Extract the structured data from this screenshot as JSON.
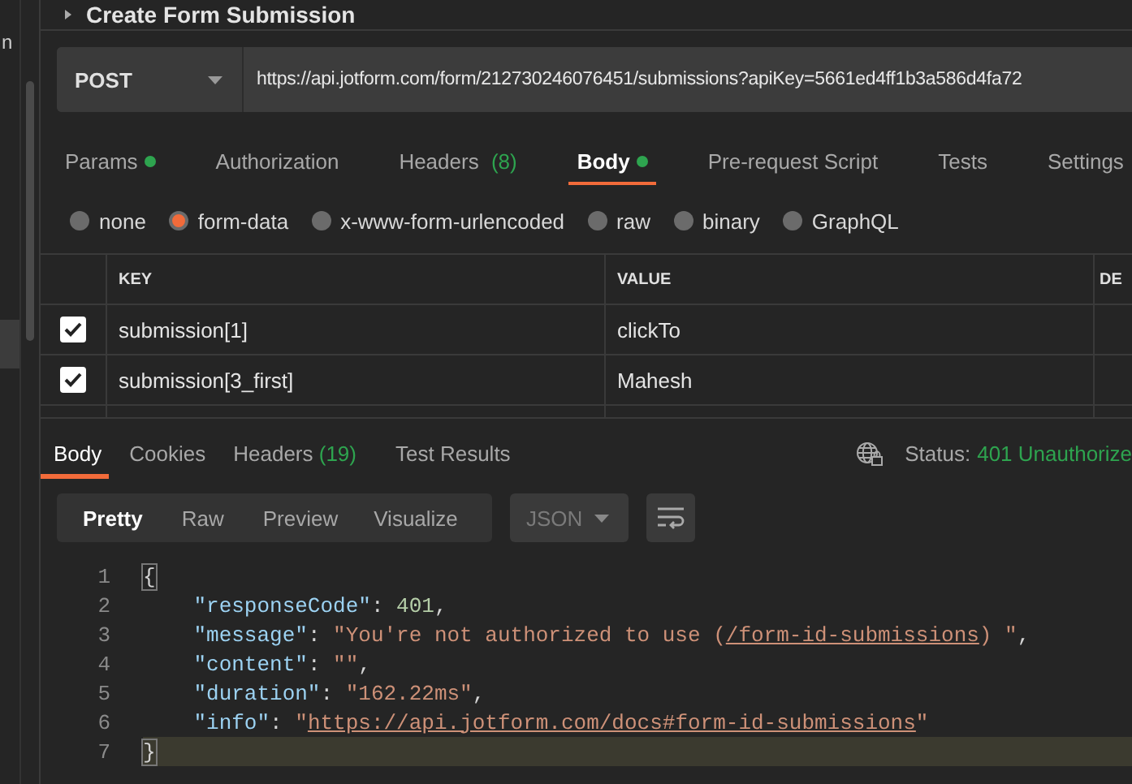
{
  "sidebar": {
    "text": "n"
  },
  "request": {
    "title": "Create Form Submission",
    "method": "POST",
    "url": "https://api.jotform.com/form/212730246076451/submissions?apiKey=5661ed4ff1b3a586d4fa72"
  },
  "tabs": [
    {
      "label": "Params",
      "dot": true,
      "selected": false
    },
    {
      "label": "Authorization",
      "dot": false,
      "selected": false
    },
    {
      "label": "Headers",
      "count": "(8)",
      "dot": false,
      "selected": false
    },
    {
      "label": "Body",
      "dot": true,
      "selected": true
    },
    {
      "label": "Pre-request Script",
      "dot": false,
      "selected": false
    },
    {
      "label": "Tests",
      "dot": false,
      "selected": false
    },
    {
      "label": "Settings",
      "dot": false,
      "selected": false
    }
  ],
  "body_types": [
    {
      "label": "none",
      "selected": false
    },
    {
      "label": "form-data",
      "selected": true
    },
    {
      "label": "x-www-form-urlencoded",
      "selected": false
    },
    {
      "label": "raw",
      "selected": false
    },
    {
      "label": "binary",
      "selected": false
    },
    {
      "label": "GraphQL",
      "selected": false
    }
  ],
  "table": {
    "columns": [
      "KEY",
      "VALUE",
      "DE"
    ],
    "rows": [
      {
        "checked": true,
        "key": "submission[1]",
        "value": "clickTo"
      },
      {
        "checked": true,
        "key": "submission[3_first]",
        "value": "Mahesh"
      }
    ]
  },
  "response_tabs": [
    {
      "label": "Body",
      "selected": true
    },
    {
      "label": "Cookies",
      "selected": false
    },
    {
      "label": "Headers",
      "count": "(19)",
      "selected": false
    },
    {
      "label": "Test Results",
      "selected": false
    }
  ],
  "status": {
    "label": "Status:",
    "value": "401 Unauthorize"
  },
  "view_modes": [
    {
      "label": "Pretty",
      "selected": true
    },
    {
      "label": "Raw",
      "selected": false
    },
    {
      "label": "Preview",
      "selected": false
    },
    {
      "label": "Visualize",
      "selected": false
    }
  ],
  "format": "JSON",
  "code": [
    {
      "number": "1",
      "current": false,
      "tokens": [
        {
          "kind": "bracket",
          "text": "{"
        }
      ]
    },
    {
      "number": "2",
      "current": false,
      "tokens": [
        {
          "kind": "key",
          "text": "\"responseCode\""
        },
        {
          "kind": "punct",
          "text": ": "
        },
        {
          "kind": "num",
          "text": "401"
        },
        {
          "kind": "punct",
          "text": ","
        }
      ]
    },
    {
      "number": "3",
      "current": false,
      "tokens": [
        {
          "kind": "key",
          "text": "\"message\""
        },
        {
          "kind": "punct",
          "text": ": "
        },
        {
          "kind": "str",
          "text": "\"You're not authorized to use ("
        },
        {
          "kind": "link",
          "text": "/form-id-submissions"
        },
        {
          "kind": "str",
          "text": ") \""
        },
        {
          "kind": "punct",
          "text": ","
        }
      ]
    },
    {
      "number": "4",
      "current": false,
      "tokens": [
        {
          "kind": "key",
          "text": "\"content\""
        },
        {
          "kind": "punct",
          "text": ": "
        },
        {
          "kind": "str",
          "text": "\"\""
        },
        {
          "kind": "punct",
          "text": ","
        }
      ]
    },
    {
      "number": "5",
      "current": false,
      "tokens": [
        {
          "kind": "key",
          "text": "\"duration\""
        },
        {
          "kind": "punct",
          "text": ": "
        },
        {
          "kind": "str",
          "text": "\"162.22ms\""
        },
        {
          "kind": "punct",
          "text": ","
        }
      ]
    },
    {
      "number": "6",
      "current": false,
      "tokens": [
        {
          "kind": "key",
          "text": "\"info\""
        },
        {
          "kind": "punct",
          "text": ": "
        },
        {
          "kind": "str",
          "text": "\""
        },
        {
          "kind": "link",
          "text": "https://api.jotform.com/docs#form-id-submissions"
        },
        {
          "kind": "str",
          "text": "\""
        }
      ]
    },
    {
      "number": "7",
      "current": true,
      "tokens": [
        {
          "kind": "bracket",
          "text": "}"
        }
      ]
    }
  ]
}
